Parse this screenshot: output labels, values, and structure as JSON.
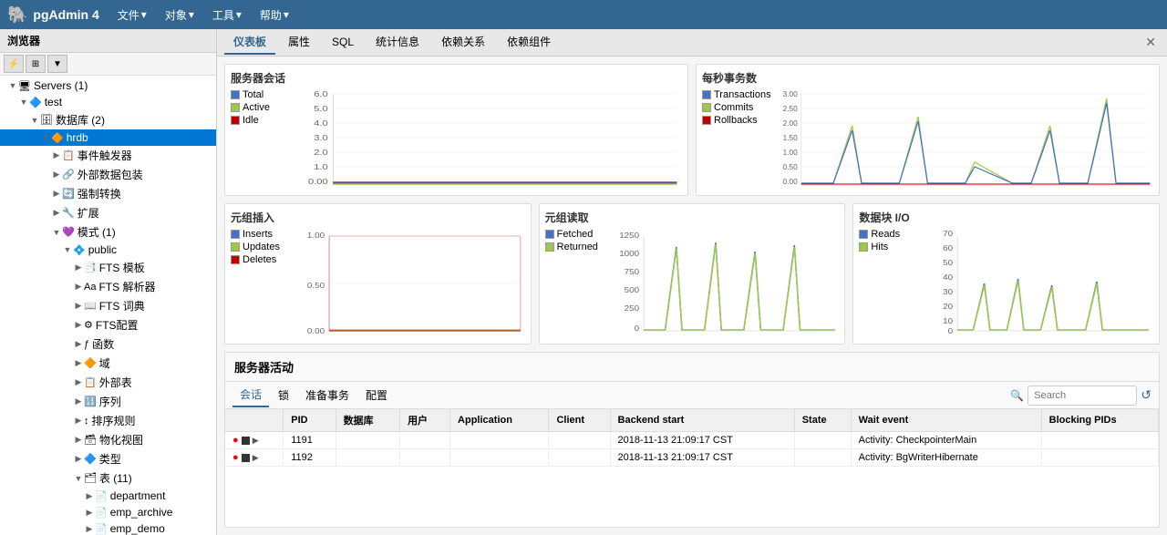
{
  "app": {
    "title": "pgAdmin 4",
    "logo": "🐘"
  },
  "topbar": {
    "menus": [
      {
        "label": "文件",
        "has_arrow": true
      },
      {
        "label": "对象",
        "has_arrow": true
      },
      {
        "label": "工具",
        "has_arrow": true
      },
      {
        "label": "帮助",
        "has_arrow": true
      }
    ]
  },
  "sidebar": {
    "title": "浏览器",
    "tree": [
      {
        "id": "servers",
        "label": "Servers (1)",
        "level": 0,
        "type": "servers",
        "expanded": true
      },
      {
        "id": "test",
        "label": "test",
        "level": 1,
        "type": "server",
        "expanded": true
      },
      {
        "id": "databases",
        "label": "数据库 (2)",
        "level": 2,
        "type": "databases",
        "expanded": true
      },
      {
        "id": "hrdb",
        "label": "hrdb",
        "level": 3,
        "type": "database",
        "expanded": true,
        "selected": true
      },
      {
        "id": "event_triggers",
        "label": "事件触发器",
        "level": 4,
        "type": "folder"
      },
      {
        "id": "ext_tables",
        "label": "外部数据包装",
        "level": 4,
        "type": "folder"
      },
      {
        "id": "forced_conv",
        "label": "强制转换",
        "level": 4,
        "type": "folder"
      },
      {
        "id": "extensions",
        "label": "扩展",
        "level": 4,
        "type": "folder"
      },
      {
        "id": "schemas",
        "label": "模式 (1)",
        "level": 4,
        "type": "folder",
        "expanded": true
      },
      {
        "id": "public",
        "label": "public",
        "level": 5,
        "type": "schema",
        "expanded": true
      },
      {
        "id": "fts_templates",
        "label": "FTS 模板",
        "level": 6,
        "type": "fts"
      },
      {
        "id": "fts_parsers",
        "label": "FTS 解析器",
        "level": 6,
        "type": "fts"
      },
      {
        "id": "fts_dict",
        "label": "FTS 词典",
        "level": 6,
        "type": "fts"
      },
      {
        "id": "fts_config",
        "label": "FTS配置",
        "level": 6,
        "type": "fts"
      },
      {
        "id": "functions",
        "label": "函数",
        "level": 6,
        "type": "functions"
      },
      {
        "id": "domains",
        "label": "域",
        "level": 6,
        "type": "domains"
      },
      {
        "id": "foreign_tables",
        "label": "外部表",
        "level": 6,
        "type": "tables"
      },
      {
        "id": "sequences",
        "label": "序列",
        "level": 6,
        "type": "sequences"
      },
      {
        "id": "sort_rules",
        "label": "排序规则",
        "level": 6,
        "type": "sort"
      },
      {
        "id": "mat_views",
        "label": "物化视图",
        "level": 6,
        "type": "views"
      },
      {
        "id": "types",
        "label": "类型",
        "level": 6,
        "type": "types"
      },
      {
        "id": "tables",
        "label": "表 (11)",
        "level": 6,
        "type": "tables",
        "expanded": true
      },
      {
        "id": "department",
        "label": "department",
        "level": 7,
        "type": "table"
      },
      {
        "id": "emp_archive",
        "label": "emp_archive",
        "level": 7,
        "type": "table"
      },
      {
        "id": "emp_demo",
        "label": "emp_demo",
        "level": 7,
        "type": "table"
      }
    ]
  },
  "tabs": {
    "items": [
      {
        "label": "仪表板",
        "active": true
      },
      {
        "label": "属性"
      },
      {
        "label": "SQL"
      },
      {
        "label": "统计信息"
      },
      {
        "label": "依赖关系"
      },
      {
        "label": "依赖组件"
      }
    ]
  },
  "charts": {
    "sessions": {
      "title": "服务器会话",
      "legend": [
        {
          "label": "Total",
          "color": "#4472C4"
        },
        {
          "label": "Active",
          "color": "#9DC946"
        },
        {
          "label": "Idle",
          "color": "#C00000"
        }
      ],
      "y_max": 6,
      "y_labels": [
        "6.0",
        "5.0",
        "4.0",
        "3.0",
        "2.0",
        "1.0",
        "0.00"
      ]
    },
    "transactions": {
      "title": "每秒事务数",
      "legend": [
        {
          "label": "Transactions",
          "color": "#4472C4"
        },
        {
          "label": "Commits",
          "color": "#9DC946"
        },
        {
          "label": "Rollbacks",
          "color": "#C00000"
        }
      ],
      "y_labels": [
        "3.00",
        "2.50",
        "2.00",
        "1.50",
        "1.00",
        "0.50",
        "0.00"
      ]
    },
    "tuples_in": {
      "title": "元组插入",
      "legend": [
        {
          "label": "Inserts",
          "color": "#4472C4"
        },
        {
          "label": "Updates",
          "color": "#9DC946"
        },
        {
          "label": "Deletes",
          "color": "#C00000"
        }
      ],
      "y_labels": [
        "1.00",
        "",
        "0.50",
        "",
        "0.00"
      ]
    },
    "tuples_out": {
      "title": "元组读取",
      "legend": [
        {
          "label": "Fetched",
          "color": "#4472C4"
        },
        {
          "label": "Returned",
          "color": "#9DC946"
        }
      ],
      "y_labels": [
        "1250",
        "1000",
        "750",
        "500",
        "250",
        "0"
      ]
    },
    "block_io": {
      "title": "数据块 I/O",
      "legend": [
        {
          "label": "Reads",
          "color": "#4472C4"
        },
        {
          "label": "Hits",
          "color": "#9DC946"
        }
      ],
      "y_labels": [
        "70",
        "60",
        "50",
        "40",
        "30",
        "20",
        "10",
        "0"
      ]
    }
  },
  "activity": {
    "title": "服务器活动",
    "tabs": [
      {
        "label": "会话",
        "active": true
      },
      {
        "label": "锁"
      },
      {
        "label": "准备事务"
      },
      {
        "label": "配置"
      }
    ],
    "search_placeholder": "Search",
    "columns": [
      "PID",
      "数据库",
      "用户",
      "Application",
      "Client",
      "Backend start",
      "State",
      "Wait event",
      "Blocking PIDs"
    ],
    "rows": [
      {
        "pid": "1191",
        "database": "",
        "user": "",
        "application": "",
        "client": "",
        "backend_start": "2018-11-13 21:09:17 CST",
        "state": "",
        "wait_event": "Activity: CheckpointerMain",
        "blocking_pids": ""
      },
      {
        "pid": "1192",
        "database": "",
        "user": "",
        "application": "",
        "client": "",
        "backend_start": "2018-11-13 21:09:17 CST",
        "state": "",
        "wait_event": "Activity: BgWriterHibernate",
        "blocking_pids": ""
      }
    ]
  }
}
